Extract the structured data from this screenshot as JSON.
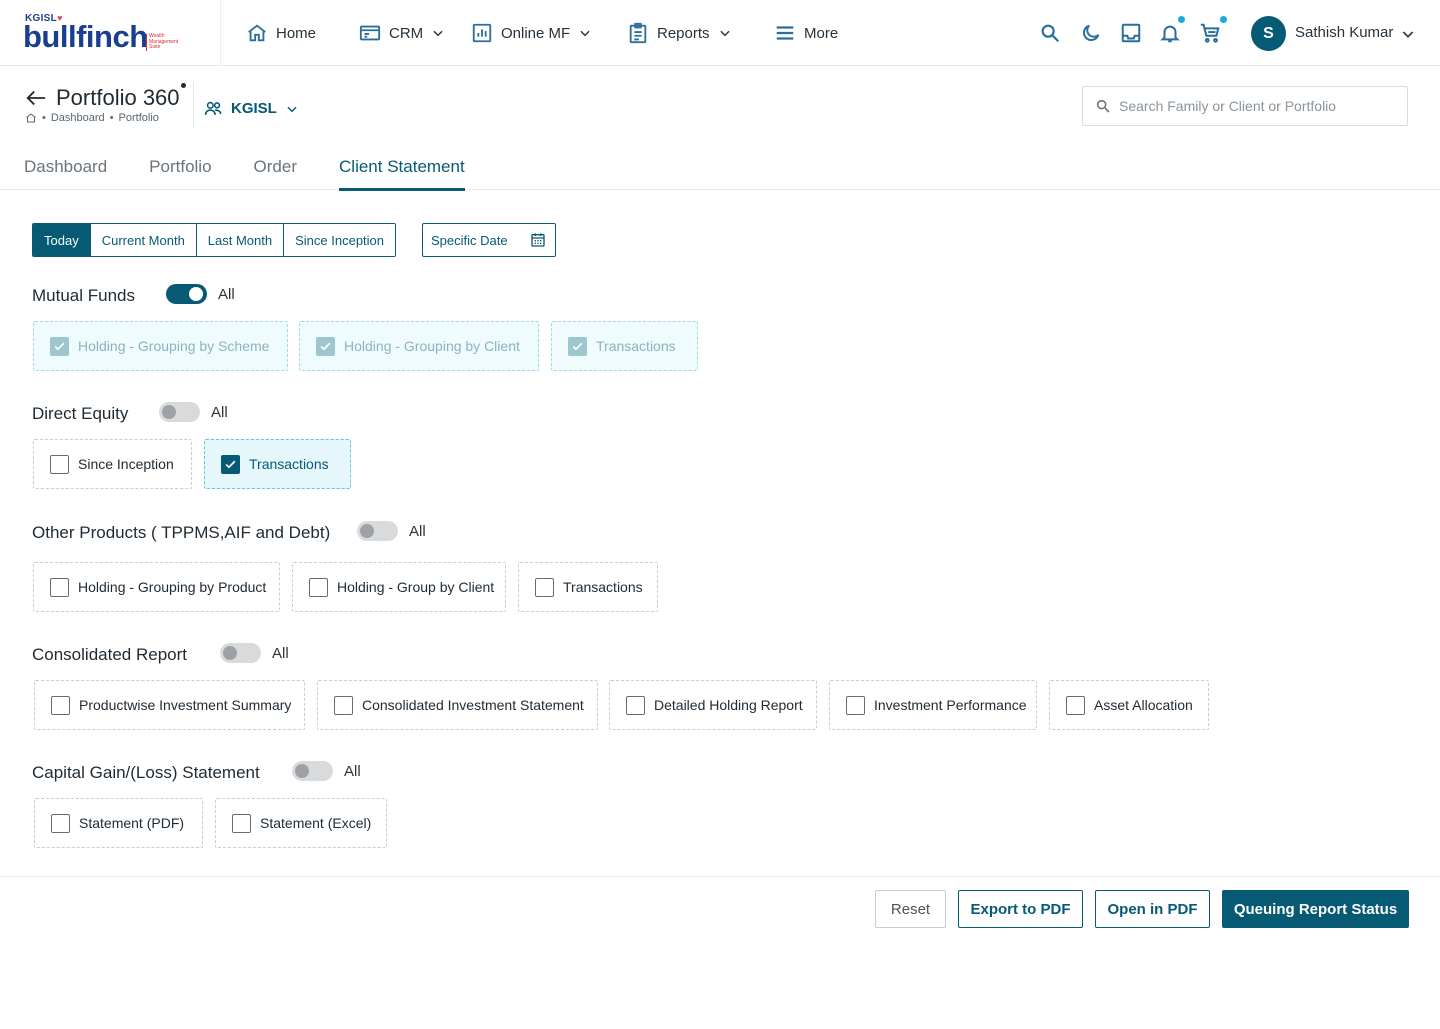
{
  "brand": {
    "kgisl": "KGISL",
    "name": "bullfinch",
    "tagline": "Wealth Management Suite"
  },
  "nav": [
    {
      "label": "Home",
      "icon": "home-icon"
    },
    {
      "label": "CRM",
      "icon": "crm-icon"
    },
    {
      "label": "Online MF",
      "icon": "chart-icon"
    },
    {
      "label": "Reports",
      "icon": "clipboard-icon"
    },
    {
      "label": "More",
      "icon": "menu-icon"
    }
  ],
  "user": {
    "initial": "S",
    "name": "Sathish Kumar"
  },
  "page": {
    "title": "Portfolio 360",
    "crumbs": [
      "Dashboard",
      "Portfolio"
    ],
    "entity": "KGISL",
    "search_placeholder": "Search Family or Client or Portfolio"
  },
  "tabs": [
    "Dashboard",
    "Portfolio",
    "Order",
    "Client Statement"
  ],
  "active_tab": "Client Statement",
  "periods": [
    "Today",
    "Current Month",
    "Last Month",
    "Since Inception"
  ],
  "active_period": "Today",
  "specific_date_label": "Specific Date",
  "all_label": "All",
  "sections": [
    {
      "title": "Mutual Funds",
      "toggle": true,
      "options": [
        {
          "label": "Holding - Grouping by Scheme",
          "state": "disabled-checked"
        },
        {
          "label": "Holding - Grouping by Client",
          "state": "disabled-checked"
        },
        {
          "label": "Transactions",
          "state": "disabled-checked"
        }
      ]
    },
    {
      "title": "Direct Equity",
      "toggle": false,
      "options": [
        {
          "label": "Since Inception",
          "state": "unchecked"
        },
        {
          "label": "Transactions",
          "state": "checked"
        }
      ]
    },
    {
      "title": "Other Products ( TPPMS,AIF and Debt)",
      "toggle": false,
      "options": [
        {
          "label": "Holding - Grouping by Product",
          "state": "unchecked"
        },
        {
          "label": "Holding - Group by Client",
          "state": "unchecked"
        },
        {
          "label": "Transactions",
          "state": "unchecked"
        }
      ]
    },
    {
      "title": "Consolidated Report",
      "toggle": false,
      "options": [
        {
          "label": "Productwise Investment Summary",
          "state": "unchecked"
        },
        {
          "label": "Consolidated Investment Statement",
          "state": "unchecked"
        },
        {
          "label": "Detailed Holding Report",
          "state": "unchecked"
        },
        {
          "label": "Investment Performance",
          "state": "unchecked"
        },
        {
          "label": "Asset Allocation",
          "state": "unchecked"
        }
      ]
    },
    {
      "title": "Capital Gain/(Loss) Statement",
      "toggle": false,
      "options": [
        {
          "label": "Statement (PDF)",
          "state": "unchecked"
        },
        {
          "label": "Statement (Excel)",
          "state": "unchecked"
        }
      ]
    }
  ],
  "buttons": {
    "reset": "Reset",
    "export_pdf": "Export to PDF",
    "open_pdf": "Open in PDF",
    "queue": "Queuing Report Status"
  },
  "colors": {
    "primary": "#065a74",
    "accent_dot": "#1ba9e0"
  }
}
